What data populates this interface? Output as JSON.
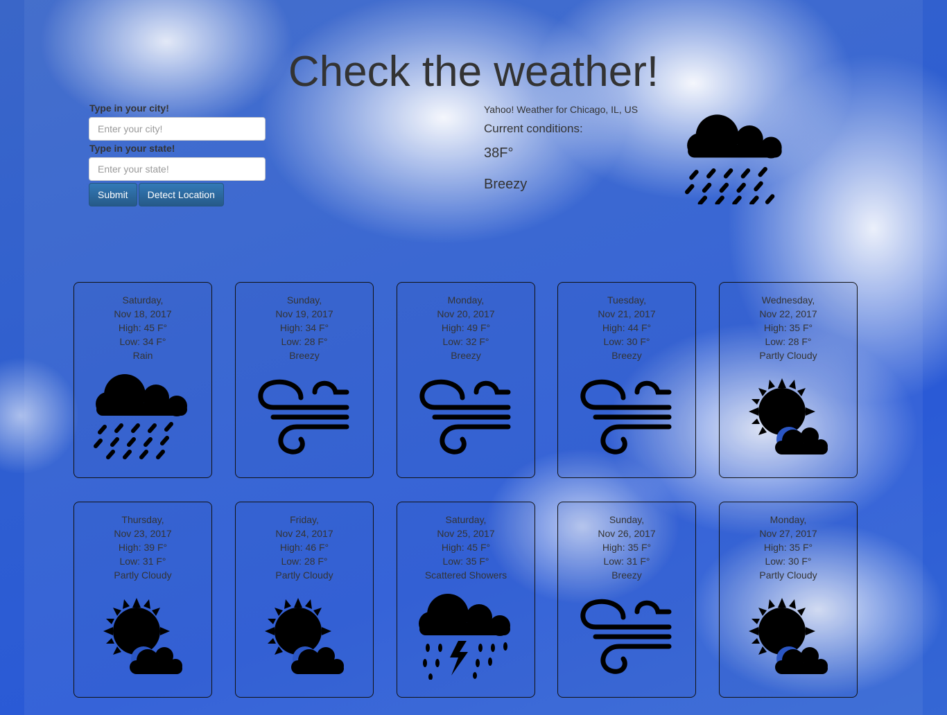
{
  "title": "Check the weather!",
  "form": {
    "city_label": "Type in your city!",
    "city_placeholder": "Enter your city!",
    "state_label": "Type in your state!",
    "state_placeholder": "Enter your state!",
    "submit_label": "Submit",
    "detect_label": "Detect Location"
  },
  "current": {
    "source": "Yahoo! Weather for Chicago, IL, US",
    "heading": "Current conditions:",
    "temp": "38F°",
    "condition": "Breezy",
    "icon": "rain-icon"
  },
  "forecast": [
    {
      "day": "Saturday,",
      "date": "Nov 18, 2017",
      "high": "High: 45 F°",
      "low": "Low: 34 F°",
      "text": "Rain",
      "icon": "rain"
    },
    {
      "day": "Sunday,",
      "date": "Nov 19, 2017",
      "high": "High: 34 F°",
      "low": "Low: 28 F°",
      "text": "Breezy",
      "icon": "wind"
    },
    {
      "day": "Monday,",
      "date": "Nov 20, 2017",
      "high": "High: 49 F°",
      "low": "Low: 32 F°",
      "text": "Breezy",
      "icon": "wind"
    },
    {
      "day": "Tuesday,",
      "date": "Nov 21, 2017",
      "high": "High: 44 F°",
      "low": "Low: 30 F°",
      "text": "Breezy",
      "icon": "wind"
    },
    {
      "day": "Wednesday,",
      "date": "Nov 22, 2017",
      "high": "High: 35 F°",
      "low": "Low: 28 F°",
      "text": "Partly Cloudy",
      "icon": "partly"
    },
    {
      "day": "Thursday,",
      "date": "Nov 23, 2017",
      "high": "High: 39 F°",
      "low": "Low: 31 F°",
      "text": "Partly Cloudy",
      "icon": "partly"
    },
    {
      "day": "Friday,",
      "date": "Nov 24, 2017",
      "high": "High: 46 F°",
      "low": "Low: 28 F°",
      "text": "Partly Cloudy",
      "icon": "partly"
    },
    {
      "day": "Saturday,",
      "date": "Nov 25, 2017",
      "high": "High: 45 F°",
      "low": "Low: 35 F°",
      "text": "Scattered Showers",
      "icon": "storm"
    },
    {
      "day": "Sunday,",
      "date": "Nov 26, 2017",
      "high": "High: 35 F°",
      "low": "Low: 31 F°",
      "text": "Breezy",
      "icon": "wind"
    },
    {
      "day": "Monday,",
      "date": "Nov 27, 2017",
      "high": "High: 35 F°",
      "low": "Low: 30 F°",
      "text": "Partly Cloudy",
      "icon": "partly"
    }
  ]
}
